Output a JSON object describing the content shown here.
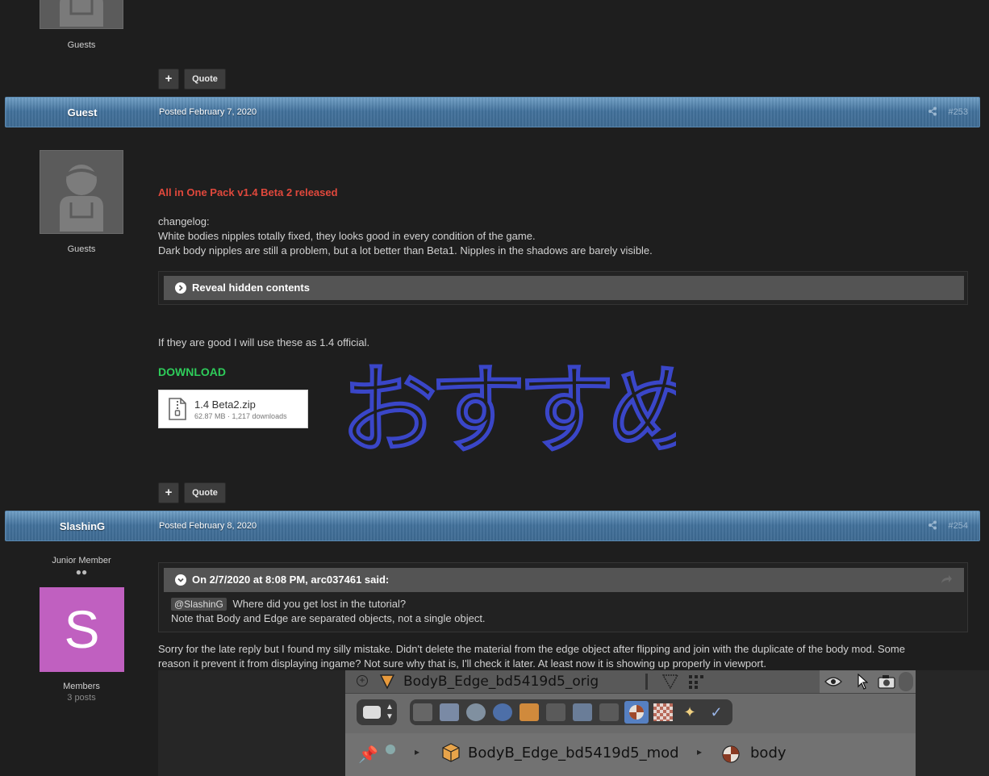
{
  "post_prev": {
    "group": "Guests",
    "actions": {
      "plus": "+",
      "quote": "Quote"
    }
  },
  "post_253": {
    "author": "Guest",
    "date": "Posted February 7, 2020",
    "number": "#253",
    "group": "Guests",
    "headline": "All in One Pack v1.4 Beta 2 released",
    "changelog_label": "changelog:",
    "changelog_lines": [
      "White bodies nipples totally fixed, they looks good in every condition of the game.",
      "Dark body nipples are still a problem, but a lot better than Beta1. Nipples in the shadows are barely visible."
    ],
    "spoiler": "Reveal hidden contents",
    "closing": "If they are good I will use these as 1.4 official.",
    "download_label": "DOWNLOAD",
    "attachment": {
      "name": "1.4 Beta2.zip",
      "meta": "62.87 MB · 1,217 downloads"
    },
    "handwriting": "おすすめ",
    "actions": {
      "plus": "+",
      "quote": "Quote"
    }
  },
  "post_254": {
    "author": "SlashinG",
    "date": "Posted February 8, 2020",
    "number": "#254",
    "rank": "Junior Member",
    "rank_pips": "●●",
    "avatar_letter": "S",
    "group": "Members",
    "post_count": "3 posts",
    "quote_header": "On 2/7/2020 at 8:08 PM, arc037461 said:",
    "quote_mention": "@SlashinG",
    "quote_line1": "Where did you get lost in the tutorial?",
    "quote_line2": "Note that Body and Edge are separated objects, not a single object.",
    "reply_line1": "Sorry for the late reply but I found my silly mistake.  Didn't delete the material from the edge object after flipping and join with the duplicate of the body mod.  Some",
    "reply_line2": "reason it prevent it from displaying ingame?  Not sure why that is, I'll check it later.  At least now it is showing up properly in viewport.",
    "embedded_image": {
      "object_name": "BodyB_Edge_bd5419d5_orig",
      "mesh_name": "BodyB_Edge_bd5419d5_mod",
      "material_name": "body"
    }
  },
  "colors": {
    "headline_red": "#e0483c",
    "download_green": "#2ecc5a",
    "avatar_purple": "#c060c0",
    "header_blue": "#4a78a2",
    "handwriting_blue": "#3a46c8"
  }
}
